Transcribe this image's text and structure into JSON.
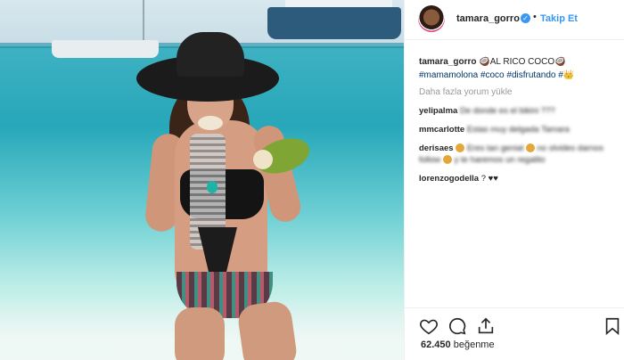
{
  "post": {
    "username": "tamara_gorro",
    "follow_label": "Takip Et",
    "caption_user": "tamara_gorro",
    "caption_text": "AL RICO COCO",
    "hashtags": [
      "#mamamolona",
      "#coco",
      "#disfrutando",
      "#"
    ],
    "load_more_comments": "Daha fazla yorum yükle",
    "comments": [
      {
        "user": "yelipalma",
        "text": "De donde es el bikini ???"
      },
      {
        "user": "mmcarlotte",
        "text": "Estas muy delgada Tamara"
      },
      {
        "user": "derisaes",
        "text": "Eres tan genial",
        "text2": "no olvides darnos follow",
        "text3": "y te haremos un regalito"
      },
      {
        "user": "lorenzogodella",
        "text": "?"
      }
    ],
    "likes_count": "62.450",
    "likes_label": "beğenme"
  },
  "icons": [
    "heart-icon",
    "comment-icon",
    "share-icon",
    "bookmark-icon",
    "verified-icon",
    "coconut-emoji-icon"
  ]
}
